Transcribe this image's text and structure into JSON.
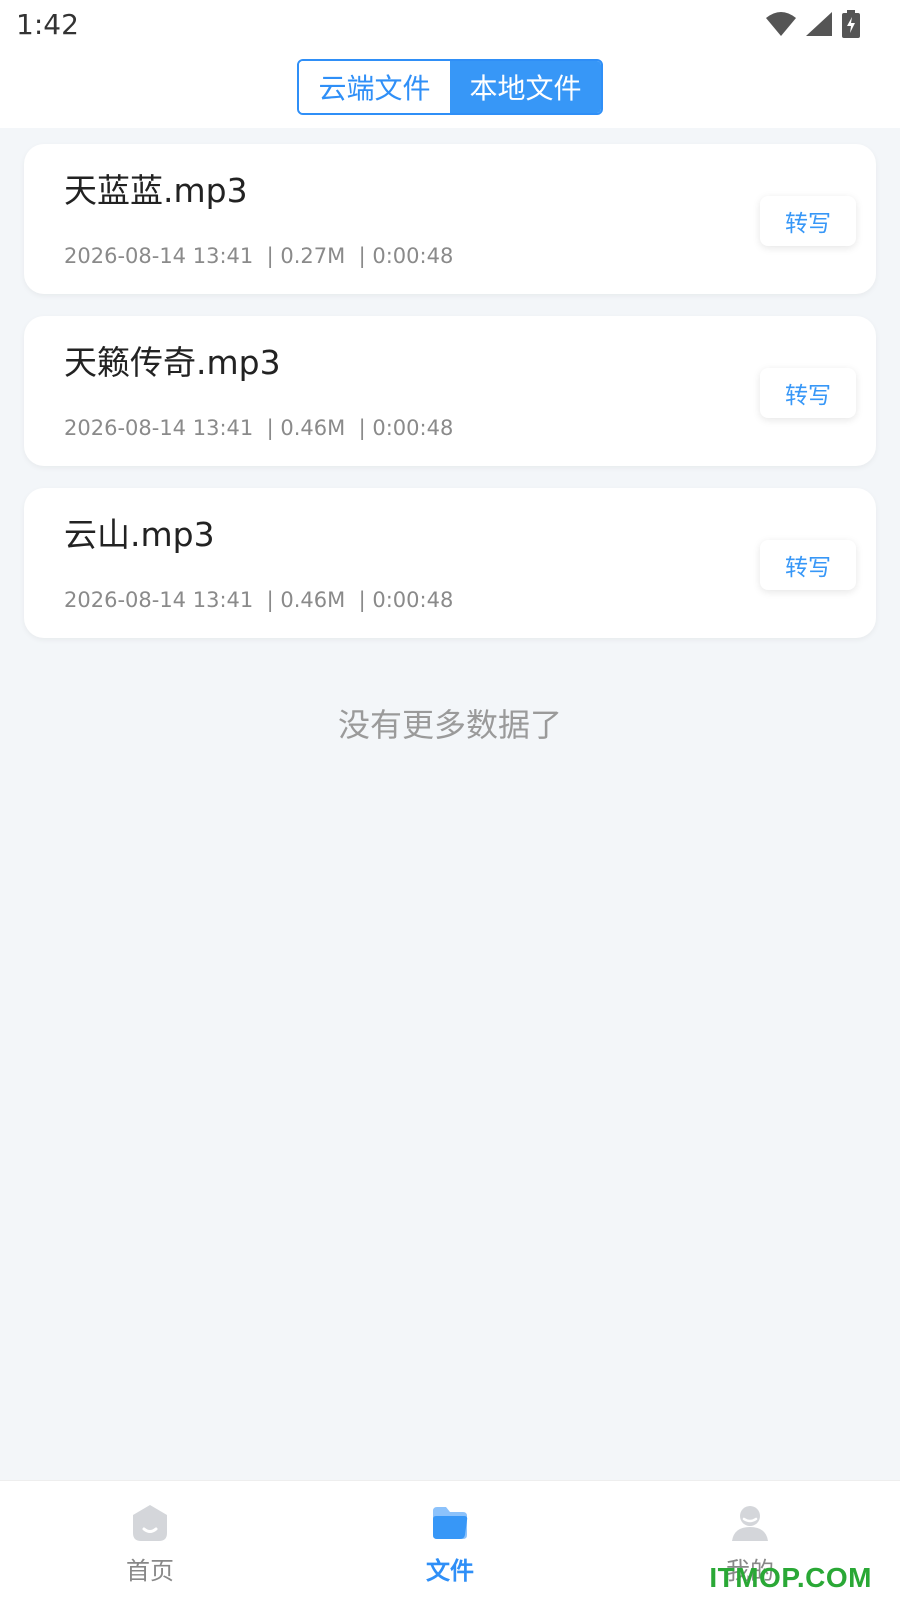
{
  "status": {
    "time": "1:42"
  },
  "segment": {
    "cloud_label": "云端文件",
    "local_label": "本地文件",
    "selected": "local"
  },
  "files": [
    {
      "name": "天蓝蓝.mp3",
      "date": "2026-08-14 13:41",
      "size": "0.27M",
      "duration": "0:00:48",
      "action": "转写"
    },
    {
      "name": "天籁传奇.mp3",
      "date": "2026-08-14 13:41",
      "size": "0.46M",
      "duration": "0:00:48",
      "action": "转写"
    },
    {
      "name": "云山.mp3",
      "date": "2026-08-14 13:41",
      "size": "0.46M",
      "duration": "0:00:48",
      "action": "转写"
    }
  ],
  "list_end_text": "没有更多数据了",
  "tabbar": {
    "home_label": "首页",
    "files_label": "文件",
    "mine_label": "我的",
    "active": "files"
  },
  "watermark": "ITMOP.COM",
  "colors": {
    "accent": "#3797f7",
    "background": "#f3f6f9",
    "watermark": "#2aa836"
  }
}
